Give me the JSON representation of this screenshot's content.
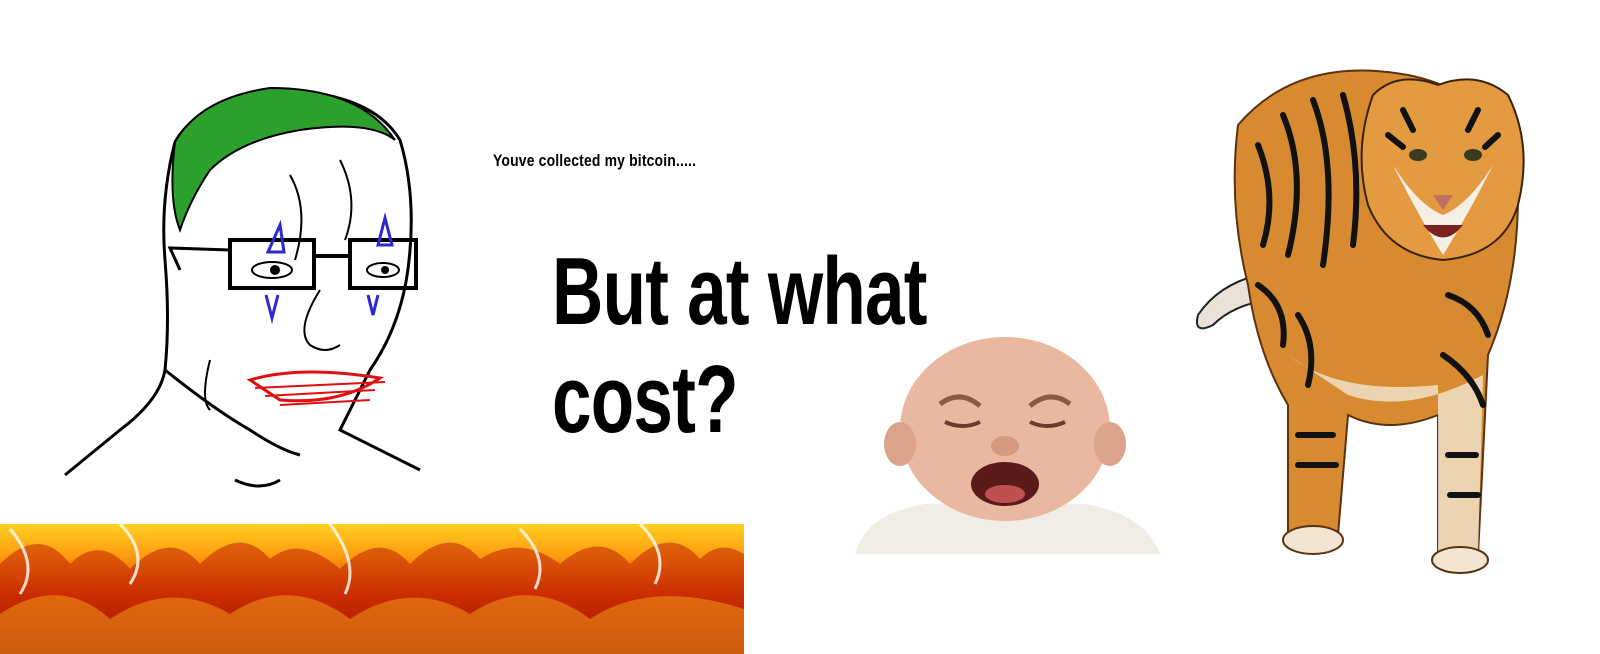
{
  "caption": {
    "small": "Youve collected my bitcoin.....",
    "big_line1": "But at what",
    "big_line2": "cost?"
  },
  "colors": {
    "background": "#ffffff",
    "hair": "#2ca02c",
    "tears": "#2a2ad0",
    "mouth_scribble": "#e01010",
    "fire_dark": "#b01800",
    "fire_bright": "#ffd020",
    "tiger_orange": "#d88a30",
    "skin": "#e8b9a0"
  },
  "icons": {
    "wojak": "crying-wojak-drawing",
    "fire": "fire-strip",
    "baby": "crying-baby-photo",
    "tiger": "walking-tiger-photo"
  }
}
